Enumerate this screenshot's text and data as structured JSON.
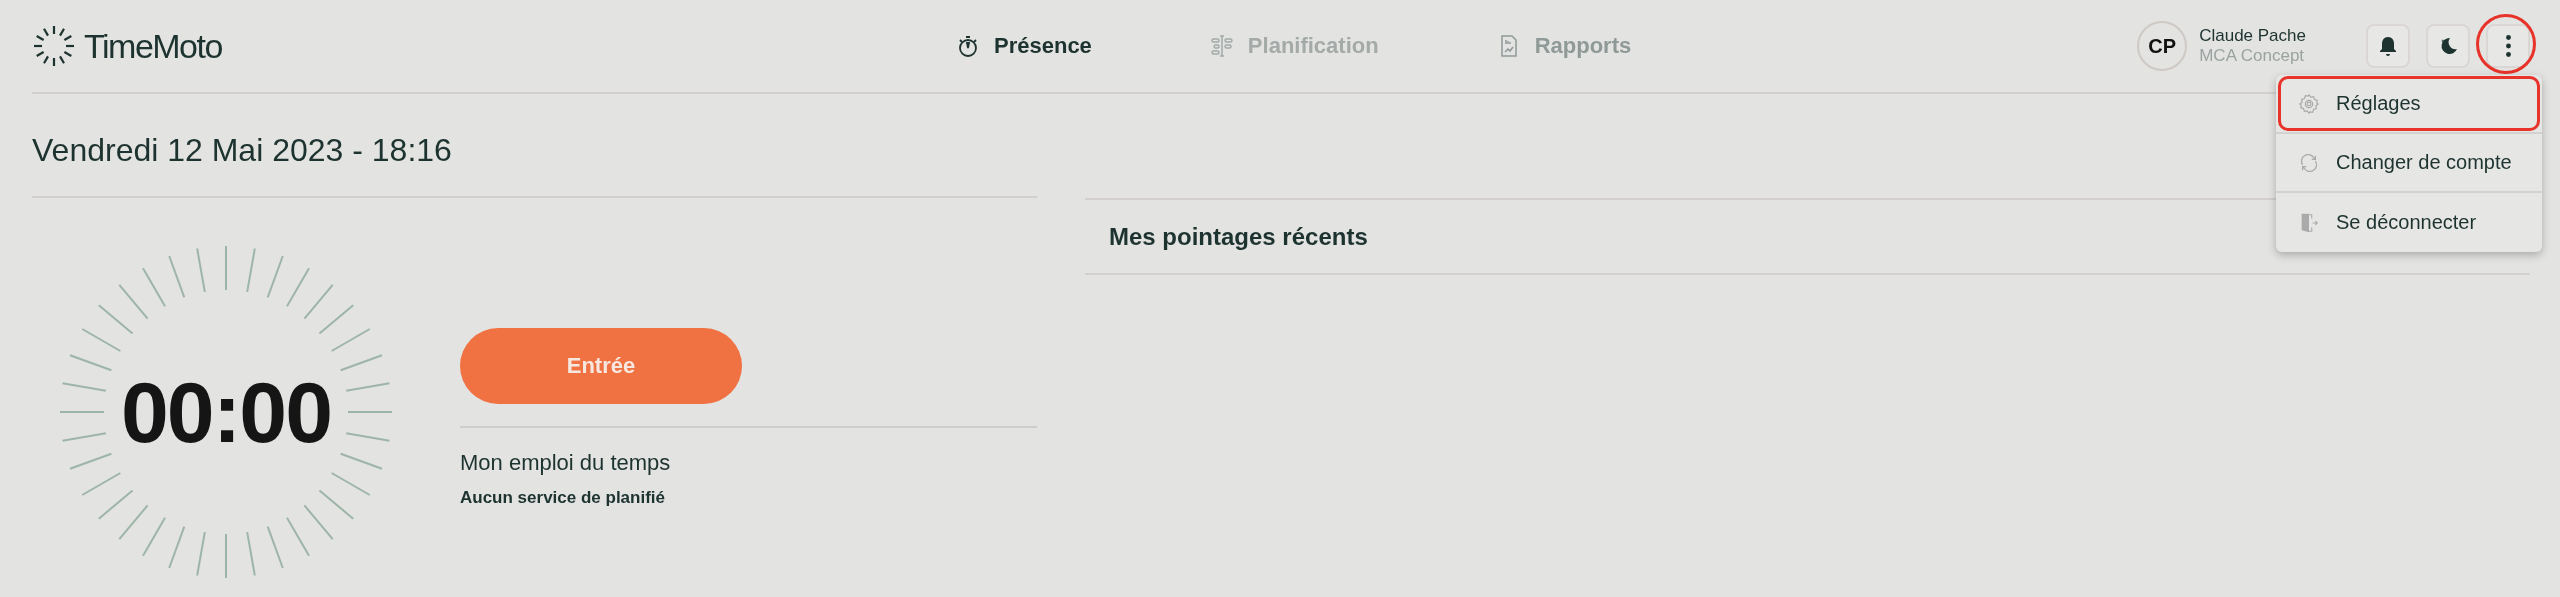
{
  "brand": "TimeMoto",
  "nav": [
    {
      "label": "Présence",
      "selected": true,
      "disabled": false
    },
    {
      "label": "Planification",
      "selected": false,
      "disabled": true
    },
    {
      "label": "Rapports",
      "selected": false,
      "disabled": false
    }
  ],
  "user": {
    "initials": "CP",
    "name": "Claude Pache",
    "company": "MCA Concept"
  },
  "header_buttons": [
    {
      "kind": "bell",
      "highlighted": false
    },
    {
      "kind": "moon",
      "highlighted": false
    },
    {
      "kind": "more",
      "highlighted": true
    }
  ],
  "menu": [
    {
      "label": "Réglages",
      "highlighted": true
    },
    {
      "label": "Changer de compte",
      "highlighted": false
    },
    {
      "label": "Se déconnecter",
      "highlighted": false
    }
  ],
  "date": "Vendredi 12 Mai 2023 - 18:16",
  "timer": "00:00",
  "clock_in_button": "Entrée",
  "schedule": {
    "title": "Mon emploi du temps",
    "status": "Aucun service de planifié"
  },
  "recent_title": "Mes pointages récents"
}
